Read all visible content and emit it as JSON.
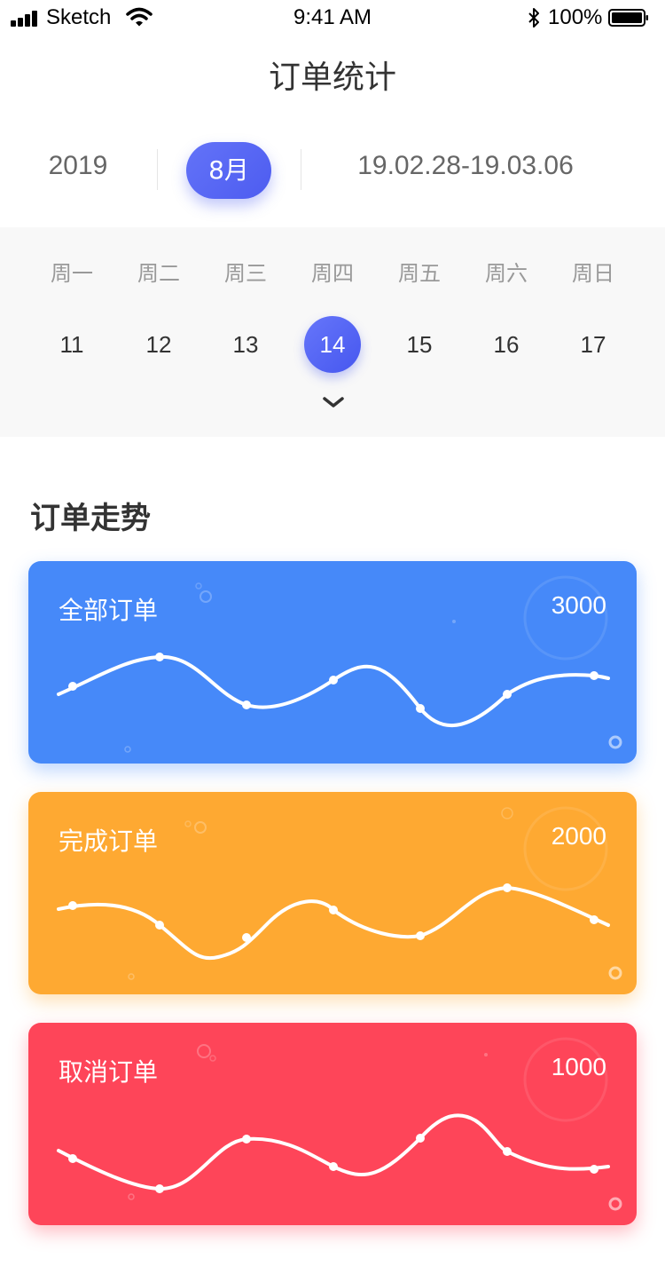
{
  "status_bar": {
    "carrier": "Sketch",
    "time": "9:41 AM",
    "battery": "100%"
  },
  "nav": {
    "title": "订单统计"
  },
  "filter": {
    "year": "2019",
    "month": "8月",
    "date_range": "19.02.28-19.03.06"
  },
  "week": {
    "weekdays": [
      "周一",
      "周二",
      "周三",
      "周四",
      "周五",
      "周六",
      "周日"
    ],
    "days": [
      "11",
      "12",
      "13",
      "14",
      "15",
      "16",
      "17"
    ],
    "selected_day": "14"
  },
  "section": {
    "title": "订单走势"
  },
  "cards": [
    {
      "label": "全部订单",
      "value": "3000",
      "color": "#4689f9"
    },
    {
      "label": "完成订单",
      "value": "2000",
      "color": "#fea932"
    },
    {
      "label": "取消订单",
      "value": "1000",
      "color": "#fe4559"
    }
  ],
  "icons": {
    "signal": "signal-bars-icon",
    "wifi": "wifi-icon",
    "bluetooth": "bluetooth-icon",
    "battery": "battery-icon",
    "expand": "chevron-down-icon"
  }
}
